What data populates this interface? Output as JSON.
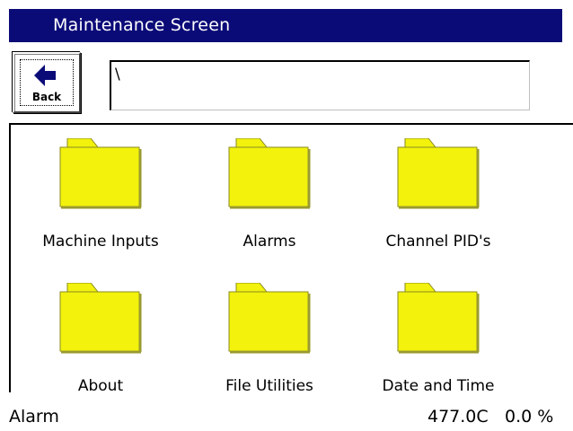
{
  "window": {
    "title": "Maintenance Screen"
  },
  "toolbar": {
    "back_label": "Back",
    "path_value": "\\"
  },
  "folders": [
    {
      "label": "Machine Inputs",
      "icon": "folder-icon"
    },
    {
      "label": "Alarms",
      "icon": "folder-icon"
    },
    {
      "label": "Channel PID's",
      "icon": "folder-icon"
    },
    {
      "label": "About",
      "icon": "folder-icon"
    },
    {
      "label": "File Utilities",
      "icon": "folder-icon"
    },
    {
      "label": "Date and Time",
      "icon": "folder-icon"
    }
  ],
  "status": {
    "left": "Alarm",
    "temperature": "477.0C",
    "percent": "0.0 %"
  },
  "colors": {
    "titlebar": "#0b0b78",
    "folder_fill": "#f2f20c",
    "folder_edge": "#8a8a22"
  }
}
